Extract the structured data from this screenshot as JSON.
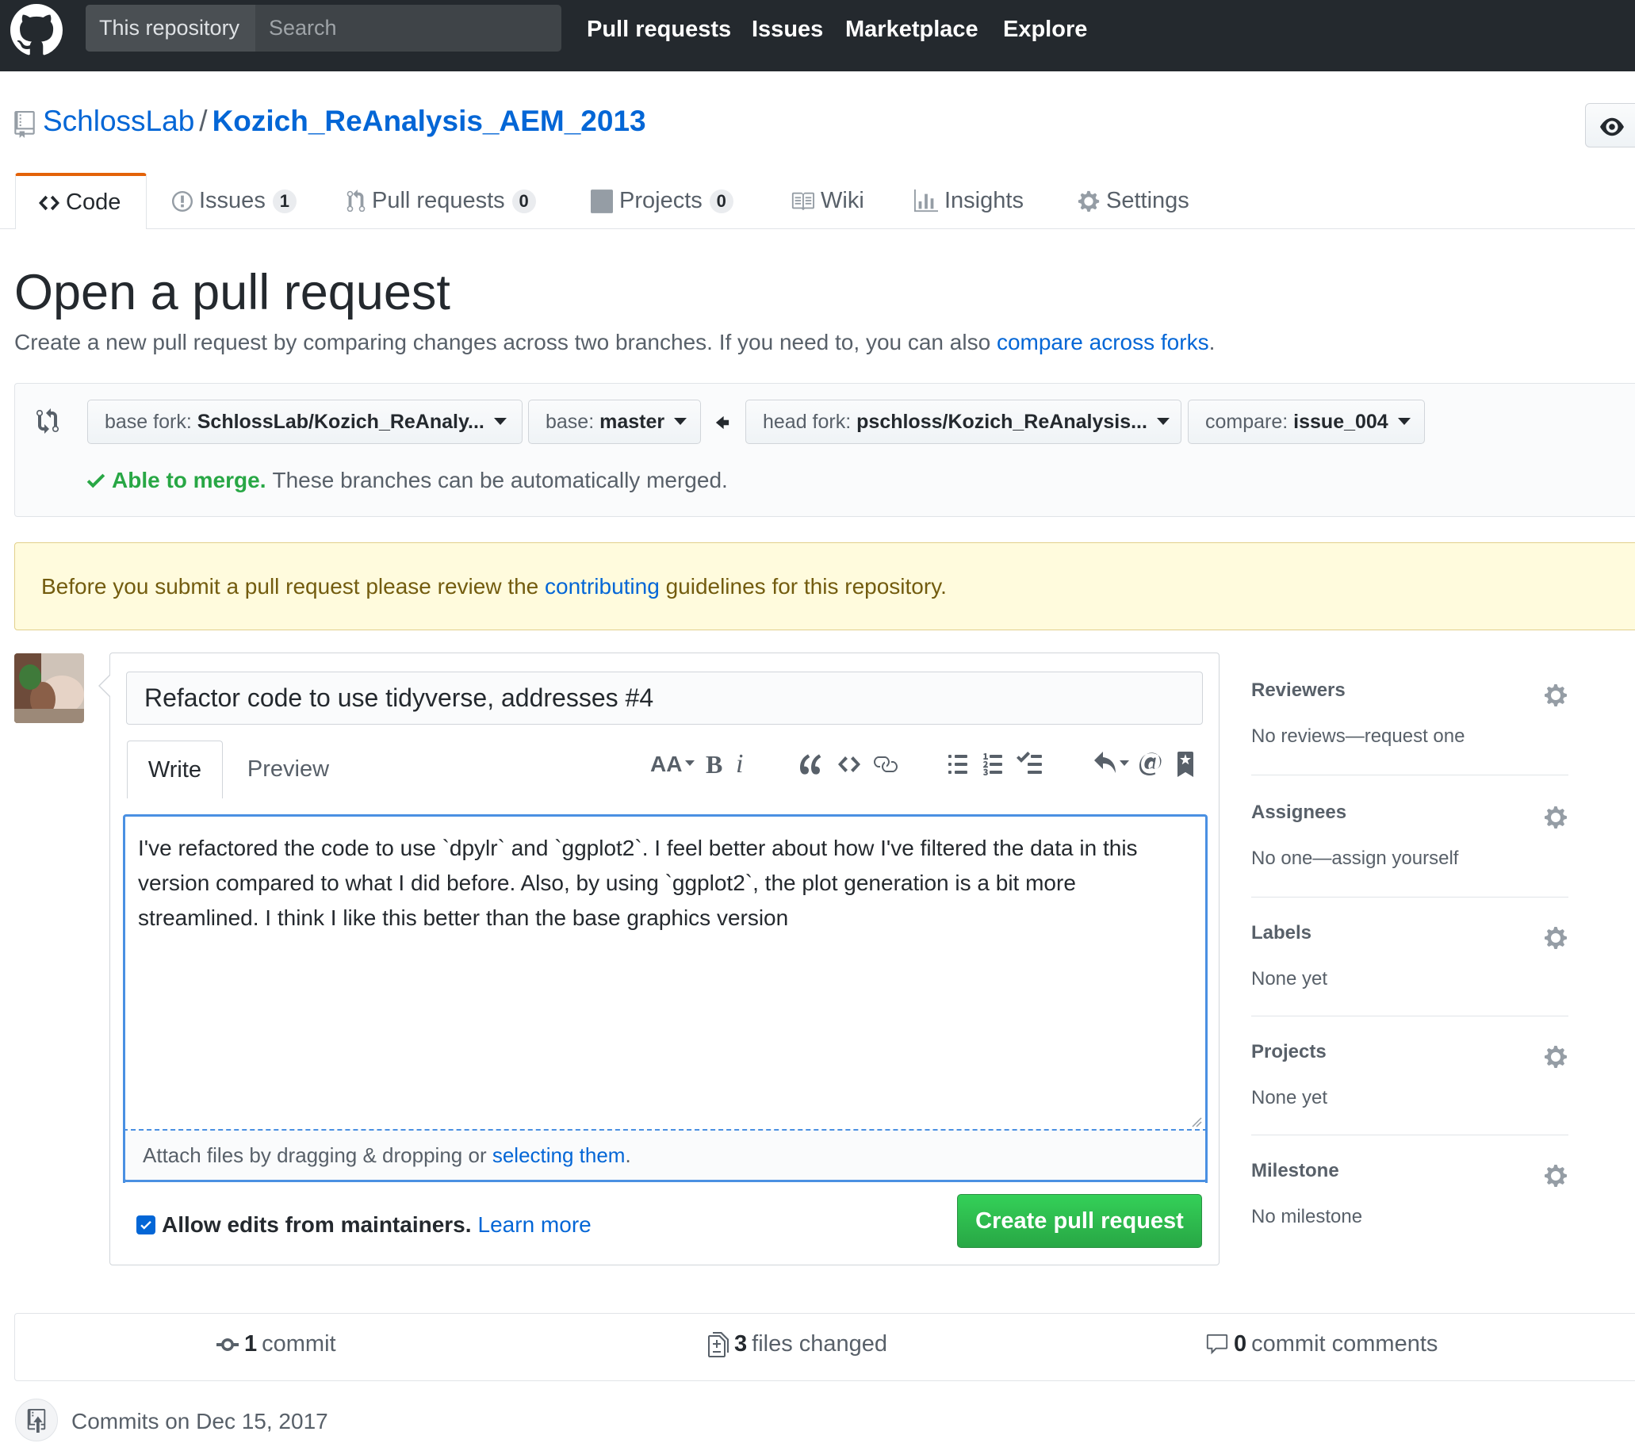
{
  "header": {
    "scope_label": "This repository",
    "search_placeholder": "Search",
    "nav": [
      "Pull requests",
      "Issues",
      "Marketplace",
      "Explore"
    ]
  },
  "repo": {
    "owner": "SchlossLab",
    "separator": "/",
    "name": "Kozich_ReAnalysis_AEM_2013"
  },
  "tabs": [
    {
      "label": "Code",
      "icon": "code-icon",
      "selected": true
    },
    {
      "label": "Issues",
      "icon": "issue-icon",
      "count": "1"
    },
    {
      "label": "Pull requests",
      "icon": "pull-request-icon",
      "count": "0"
    },
    {
      "label": "Projects",
      "icon": "project-icon",
      "count": "0"
    },
    {
      "label": "Wiki",
      "icon": "book-icon"
    },
    {
      "label": "Insights",
      "icon": "graph-icon"
    },
    {
      "label": "Settings",
      "icon": "gear-icon"
    }
  ],
  "page": {
    "title": "Open a pull request",
    "subtitle": "Create a new pull request by comparing changes across two branches. If you need to, you can also ",
    "subtitle_link": "compare across forks",
    "subtitle_end": "."
  },
  "compare": {
    "base_fork_label": "base fork:",
    "base_fork_value": "SchlossLab/Kozich_ReAnaly...",
    "base_label": "base:",
    "base_value": "master",
    "head_fork_label": "head fork:",
    "head_fork_value": "pschloss/Kozich_ReAnalysis...",
    "compare_label": "compare:",
    "compare_value": "issue_004",
    "merge_ok": "Able to merge.",
    "merge_text": "These branches can be automatically merged."
  },
  "flash": {
    "before": "Before you submit a pull request please review the ",
    "link": "contributing",
    "after": " guidelines for this repository."
  },
  "composer": {
    "title_value": "Refactor code to use tidyverse, addresses #4",
    "write_tab": "Write",
    "preview_tab": "Preview",
    "body": "I've refactored the code to use `dpylr` and `ggplot2`. I feel better about how I've filtered the data in this version compared to what I did before. Also, by using `ggplot2`, the plot generation is a bit more streamlined. I think I like this better than the base graphics version",
    "attach_text": "Attach files by dragging & dropping or ",
    "attach_link": "selecting them",
    "attach_end": ".",
    "allow_edits": "Allow edits from maintainers.",
    "learn_more": "Learn more",
    "allow_edits_checked": true,
    "create_button": "Create pull request",
    "toolbar_icons": [
      "text-size-icon",
      "bold-icon",
      "italic-icon",
      "quote-icon",
      "code-icon",
      "link-icon",
      "bullet-list-icon",
      "numbered-list-icon",
      "task-list-icon",
      "reply-icon",
      "mention-icon",
      "bookmark-icon"
    ]
  },
  "sidebar": [
    {
      "heading": "Reviewers",
      "value": "No reviews—request one"
    },
    {
      "heading": "Assignees",
      "value": "No one—assign yourself"
    },
    {
      "heading": "Labels",
      "value": "None yet"
    },
    {
      "heading": "Projects",
      "value": "None yet"
    },
    {
      "heading": "Milestone",
      "value": "No milestone"
    }
  ],
  "summary": {
    "commits_count": "1",
    "commits_label": "commit",
    "files_count": "3",
    "files_label": "files changed",
    "comments_count": "0",
    "comments_label": "commit comments",
    "commits_day": "Commits on Dec 15, 2017"
  },
  "colors": {
    "header_bg": "#24292e",
    "link": "#0366d6",
    "success": "#28a745",
    "tab_accent": "#e36209",
    "flash_bg": "#fffbdd"
  }
}
